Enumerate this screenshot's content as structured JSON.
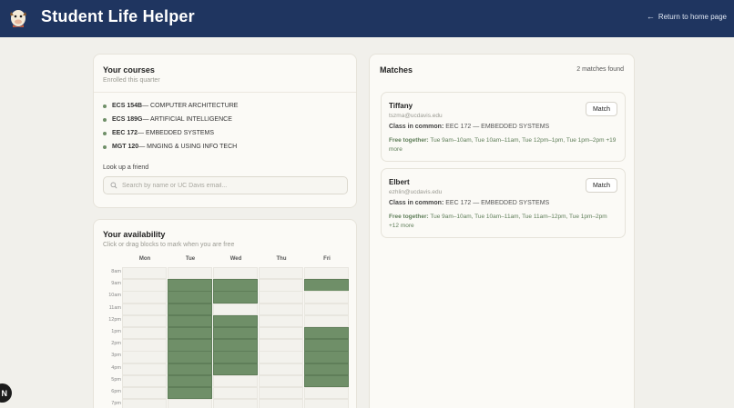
{
  "header": {
    "title": "Student Life Helper",
    "home_link": "Return to home page",
    "logo_icon": "cow-mascot-icon"
  },
  "courses": {
    "title": "Your courses",
    "subtitle": "Enrolled this quarter",
    "items": [
      {
        "code": "ECS 154B",
        "name": " — COMPUTER ARCHITECTURE"
      },
      {
        "code": "ECS 189G",
        "name": " — ARTIFICIAL INTELLIGENCE"
      },
      {
        "code": "EEC 172",
        "name": " — EMBEDDED SYSTEMS"
      },
      {
        "code": "MGT 120",
        "name": " — MNGING & USING INFO TECH"
      }
    ],
    "lookup_label": "Look up a friend",
    "search_placeholder": "Search by name or UC Davis email..."
  },
  "availability": {
    "title": "Your availability",
    "subtitle": "Click or drag blocks to mark when you are free",
    "days": [
      "Mon",
      "Tue",
      "Wed",
      "Thu",
      "Fri"
    ],
    "times": [
      "8am",
      "9am",
      "10am",
      "11am",
      "12pm",
      "1pm",
      "2pm",
      "3pm",
      "4pm",
      "5pm",
      "6pm",
      "7pm"
    ],
    "selected": [
      [
        0,
        0,
        0,
        0,
        0
      ],
      [
        0,
        1,
        1,
        0,
        1
      ],
      [
        0,
        1,
        1,
        0,
        0
      ],
      [
        0,
        1,
        0,
        0,
        0
      ],
      [
        0,
        1,
        1,
        0,
        0
      ],
      [
        0,
        1,
        1,
        0,
        1
      ],
      [
        0,
        1,
        1,
        0,
        1
      ],
      [
        0,
        1,
        1,
        0,
        1
      ],
      [
        0,
        1,
        1,
        0,
        1
      ],
      [
        0,
        1,
        0,
        0,
        1
      ],
      [
        0,
        1,
        0,
        0,
        0
      ],
      [
        0,
        0,
        0,
        0,
        0
      ]
    ]
  },
  "matches": {
    "title": "Matches",
    "count": "2 matches found",
    "items": [
      {
        "name": "Tiffany",
        "email": "tszma@ucdavis.edu",
        "common_label": "Class in common:",
        "common_value": " EEC 172 — EMBEDDED SYSTEMS",
        "free_label": "Free together:",
        "free_value": " Tue 9am–10am, Tue 10am–11am, Tue 12pm–1pm, Tue 1pm–2pm +19 more",
        "button": "Match"
      },
      {
        "name": "Elbert",
        "email": "ezhlin@ucdavis.edu",
        "common_label": "Class in common:",
        "common_value": " EEC 172 — EMBEDDED SYSTEMS",
        "free_label": "Free together:",
        "free_value": " Tue 9am–10am, Tue 10am–11am, Tue 11am–12pm, Tue 1pm–2pm +12 more",
        "button": "Match"
      }
    ]
  },
  "badge": {
    "letter": "N"
  },
  "colors": {
    "header": "#1f3560",
    "accent": "#6f8f68",
    "background": "#f1f0eb"
  }
}
